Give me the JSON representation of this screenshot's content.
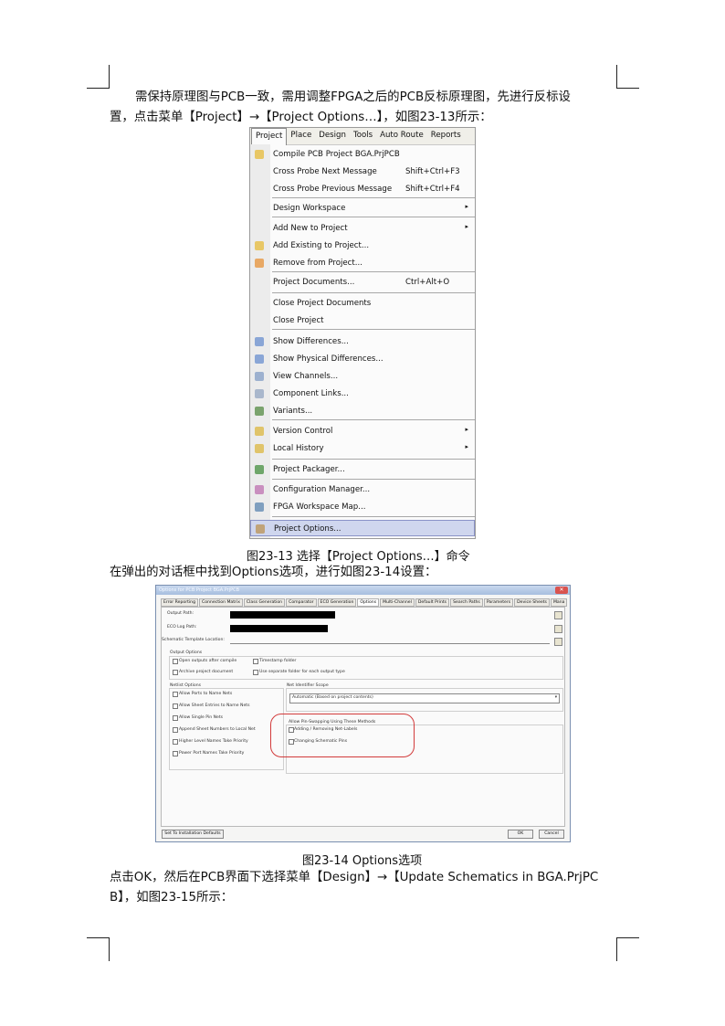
{
  "paragraph1": {
    "line1": "需保持原理图与PCB一致，需用调整FPGA之后的PCB反标原理图，先进行反标设",
    "line2": "置，点击菜单【Project】→【Project Options…】，如图23-13所示："
  },
  "menu": {
    "menubar": [
      "Project",
      "Place",
      "Design",
      "Tools",
      "Auto Route",
      "Reports"
    ],
    "items": [
      {
        "label": "Compile PCB Project BGA.PrjPCB",
        "shortcut": "",
        "icon": "compile-icon",
        "submenu": false
      },
      {
        "label": "Cross Probe Next Message",
        "shortcut": "Shift+Ctrl+F3",
        "icon": "",
        "submenu": false
      },
      {
        "label": "Cross Probe Previous Message",
        "shortcut": "Shift+Ctrl+F4",
        "icon": "",
        "submenu": false
      },
      {
        "label": "Design Workspace",
        "shortcut": "",
        "icon": "",
        "submenu": true
      },
      {
        "label": "Add New to Project",
        "shortcut": "",
        "icon": "",
        "submenu": true
      },
      {
        "label": "Add Existing to Project...",
        "shortcut": "",
        "icon": "add-existing-icon",
        "submenu": false
      },
      {
        "label": "Remove from Project...",
        "shortcut": "",
        "icon": "remove-icon",
        "submenu": false
      },
      {
        "label": "Project Documents...",
        "shortcut": "Ctrl+Alt+O",
        "icon": "",
        "submenu": false
      },
      {
        "label": "Close Project Documents",
        "shortcut": "",
        "icon": "",
        "submenu": false
      },
      {
        "label": "Close Project",
        "shortcut": "",
        "icon": "",
        "submenu": false
      },
      {
        "label": "Show Differences...",
        "shortcut": "",
        "icon": "differences-icon",
        "submenu": false
      },
      {
        "label": "Show Physical Differences...",
        "shortcut": "",
        "icon": "physical-differences-icon",
        "submenu": false
      },
      {
        "label": "View Channels...",
        "shortcut": "",
        "icon": "channels-icon",
        "submenu": false
      },
      {
        "label": "Component Links...",
        "shortcut": "",
        "icon": "component-links-icon",
        "submenu": false
      },
      {
        "label": "Variants...",
        "shortcut": "",
        "icon": "variants-icon",
        "submenu": false
      },
      {
        "label": "Version Control",
        "shortcut": "",
        "icon": "lock-icon",
        "submenu": true
      },
      {
        "label": "Local History",
        "shortcut": "",
        "icon": "lock-icon",
        "submenu": true
      },
      {
        "label": "Project Packager...",
        "shortcut": "",
        "icon": "packager-icon",
        "submenu": false
      },
      {
        "label": "Configuration Manager...",
        "shortcut": "",
        "icon": "config-icon",
        "submenu": false
      },
      {
        "label": "FPGA Workspace Map...",
        "shortcut": "",
        "icon": "fpga-map-icon",
        "submenu": false
      },
      {
        "label": "Project Options...",
        "shortcut": "",
        "icon": "options-icon",
        "submenu": false
      }
    ]
  },
  "caption1": "图23-13  选择【Project Options…】命令",
  "paragraph2": "在弹出的对话框中找到Options选项，进行如图23-14设置：",
  "dialog": {
    "title": "Options for PCB Project BGA.PrjPCB",
    "close_glyph": "✕",
    "tabs": [
      "Error Reporting",
      "Connection Matrix",
      "Class Generation",
      "Comparator",
      "ECO Generation",
      "Options",
      "Multi-Channel",
      "Default Prints",
      "Search Paths",
      "Parameters",
      "Device Sheets",
      "Mana"
    ],
    "output_path_label": "Output Path:",
    "ecolog_path_label": "ECO Log Path:",
    "template_label": "Schematic Template Location:",
    "output_options_title": "Output Options",
    "open_outputs": "Open outputs after compile",
    "timestamp_folder": "Timestamp folder",
    "archive_project": "Archive project document",
    "separate_folder": "Use separate folder for each output type",
    "netlist_options_title": "Netlist Options",
    "netlist_options": [
      "Allow Ports to Name Nets",
      "Allow Sheet Entries to Name Nets",
      "Allow Single Pin Nets",
      "Append Sheet Numbers to Local Net",
      "Higher Level Names Take Priority",
      "Power Port Names Take Priority"
    ],
    "net_scope_title": "Net Identifier Scope",
    "net_scope_value": "Automatic (Based on project contents)",
    "pin_swap_title": "Allow Pin-Swapping Using These Methods",
    "pin_swap_options": [
      "Adding / Removing Net-Labels",
      "Changing Schematic Pins"
    ],
    "set_defaults": "Set To Installation Defaults",
    "ok": "OK",
    "cancel": "Cancel"
  },
  "caption2": "图23-14 Options选项",
  "paragraph3": {
    "line1": "点击OK，然后在PCB界面下选择菜单【Design】→【Update Schematics in BGA.PrjPC",
    "line2": "B】，如图23-15所示："
  }
}
